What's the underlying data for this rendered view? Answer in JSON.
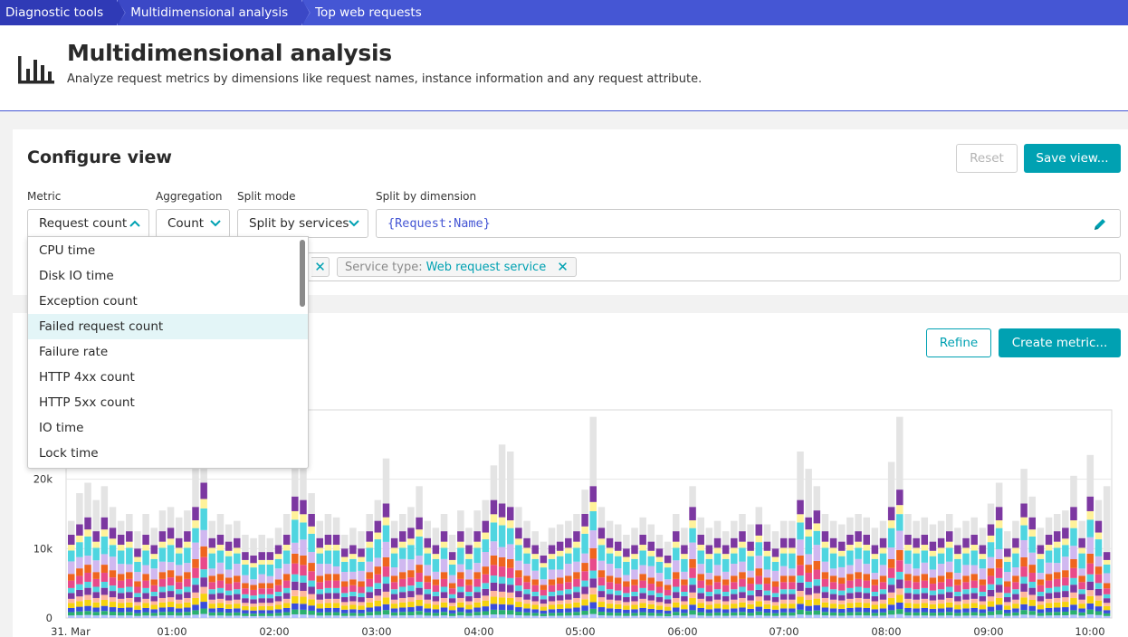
{
  "breadcrumb": [
    "Diagnostic tools",
    "Multidimensional analysis",
    "Top web requests"
  ],
  "header": {
    "title": "Multidimensional analysis",
    "subtitle": "Analyze request metrics by dimensions like request names, instance information and any request attribute."
  },
  "configure": {
    "title": "Configure view",
    "reset_label": "Reset",
    "save_label": "Save view...",
    "metric": {
      "label": "Metric",
      "value": "Request count"
    },
    "aggregation": {
      "label": "Aggregation",
      "value": "Count"
    },
    "split_mode": {
      "label": "Split mode",
      "value": "Split by services"
    },
    "split_dimension": {
      "label": "Split by dimension",
      "value": "{Request:Name}"
    },
    "filter": {
      "key": "Service type:",
      "value": "Web request service",
      "remove": "×"
    }
  },
  "metric_options": [
    "CPU time",
    "Disk IO time",
    "Exception count",
    "Failed request count",
    "Failure rate",
    "HTTP 4xx count",
    "HTTP 5xx count",
    "IO time",
    "Lock time"
  ],
  "highlighted_option": "Failed request count",
  "actions": {
    "refine_label": "Refine",
    "create_metric_label": "Create metric..."
  },
  "colors": {
    "accent": "#00a1b2",
    "brand": "#4556d4"
  },
  "chart_data": {
    "type": "bar",
    "stacked": true,
    "y_ticks": [
      "0",
      "10k",
      "20k"
    ],
    "ylim": [
      0,
      30000
    ],
    "x_ticks": [
      "31. Mar",
      "01:00",
      "02:00",
      "03:00",
      "04:00",
      "05:00",
      "06:00",
      "07:00",
      "08:00",
      "09:00",
      "10:00"
    ],
    "bar_count": 126,
    "series_colors": [
      "#b3c2ff",
      "#7c38a1",
      "#f5d30f",
      "#fff29a",
      "#e8e8e8",
      "#4fd5e0",
      "#d0b8f0",
      "#ef651f",
      "#2ab06f",
      "#3a4ddc",
      "#ffb8a0",
      "#e6e6e6"
    ],
    "totals": [
      14000,
      18000,
      19500,
      17000,
      19000,
      16000,
      14000,
      15000,
      12500,
      15000,
      13000,
      15500,
      16000,
      14500,
      15500,
      26000,
      28500,
      14000,
      15000,
      13500,
      14000,
      12000,
      11500,
      12000,
      11500,
      13000,
      15000,
      23500,
      24000,
      18000,
      14000,
      15000,
      14500,
      12000,
      13000,
      12500,
      15000,
      17000,
      23000,
      14000,
      15000,
      16000,
      19000,
      14000,
      13000,
      15000,
      12000,
      15500,
      13000,
      15500,
      17000,
      22000,
      25000,
      24000,
      16000,
      14000,
      12500,
      11000,
      13000,
      13500,
      14000,
      15000,
      18500,
      29000,
      16000,
      14000,
      13500,
      12000,
      13000,
      14500,
      13500,
      12000,
      11000,
      15000,
      13000,
      19000,
      14500,
      13000,
      14000,
      12500,
      14000,
      15000,
      13500,
      16000,
      13500,
      12500,
      14000,
      14000,
      24000,
      21500,
      19000,
      15000,
      14000,
      13500,
      14500,
      15000,
      14500,
      13000,
      14000,
      22500,
      29000,
      15000,
      14000,
      14500,
      13500,
      14000,
      15000,
      13000,
      14000,
      14500,
      13000,
      16500,
      19500,
      12500,
      14000,
      21500,
      17500,
      13000,
      14500,
      15000,
      15500,
      20500,
      14000,
      23500,
      17000,
      19000
    ],
    "colored_tops": [
      12000,
      13500,
      14500,
      12500,
      14500,
      13000,
      12000,
      12500,
      10000,
      12000,
      10500,
      12500,
      13000,
      11500,
      12500,
      16000,
      19500,
      11500,
      12000,
      11000,
      11500,
      9500,
      9000,
      9500,
      9500,
      10500,
      12000,
      17500,
      17000,
      15000,
      11500,
      12000,
      12000,
      10000,
      10500,
      10000,
      12500,
      14000,
      16500,
      11500,
      12500,
      13000,
      14500,
      11500,
      10500,
      12500,
      9500,
      12500,
      10500,
      12500,
      14000,
      17000,
      16500,
      16000,
      13000,
      11500,
      10500,
      9000,
      10500,
      11000,
      11500,
      12500,
      15000,
      19000,
      13000,
      11500,
      11000,
      10000,
      10500,
      12000,
      11000,
      10000,
      9000,
      12500,
      10500,
      16000,
      12000,
      10500,
      11500,
      10500,
      11500,
      12500,
      11000,
      13500,
      11000,
      10000,
      11500,
      11500,
      17000,
      14500,
      15500,
      12500,
      11500,
      11000,
      12000,
      12500,
      12000,
      10500,
      11500,
      16000,
      18500,
      12000,
      11500,
      12000,
      11000,
      11500,
      12500,
      10500,
      11500,
      12000,
      10500,
      13500,
      16000,
      10000,
      11500,
      16500,
      14500,
      10500,
      12000,
      12500,
      13000,
      16000,
      11500,
      17500,
      14000,
      9500
    ]
  }
}
